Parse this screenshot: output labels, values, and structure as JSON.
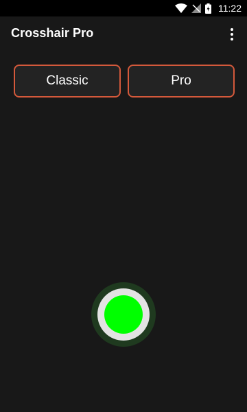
{
  "status_bar": {
    "time": "11:22",
    "icons": [
      "wifi-icon",
      "signal-icon",
      "battery-icon"
    ]
  },
  "app_bar": {
    "title": "Crosshair Pro",
    "overflow_icon": "more-vert-icon"
  },
  "modes": {
    "classic_label": "Classic",
    "pro_label": "Pro"
  },
  "toggle": {
    "icon": "crosshair-toggle-icon",
    "color": "#00ff00"
  },
  "colors": {
    "accent_border": "#d4593b",
    "background": "#181818",
    "toggle_active": "#00ff00"
  }
}
